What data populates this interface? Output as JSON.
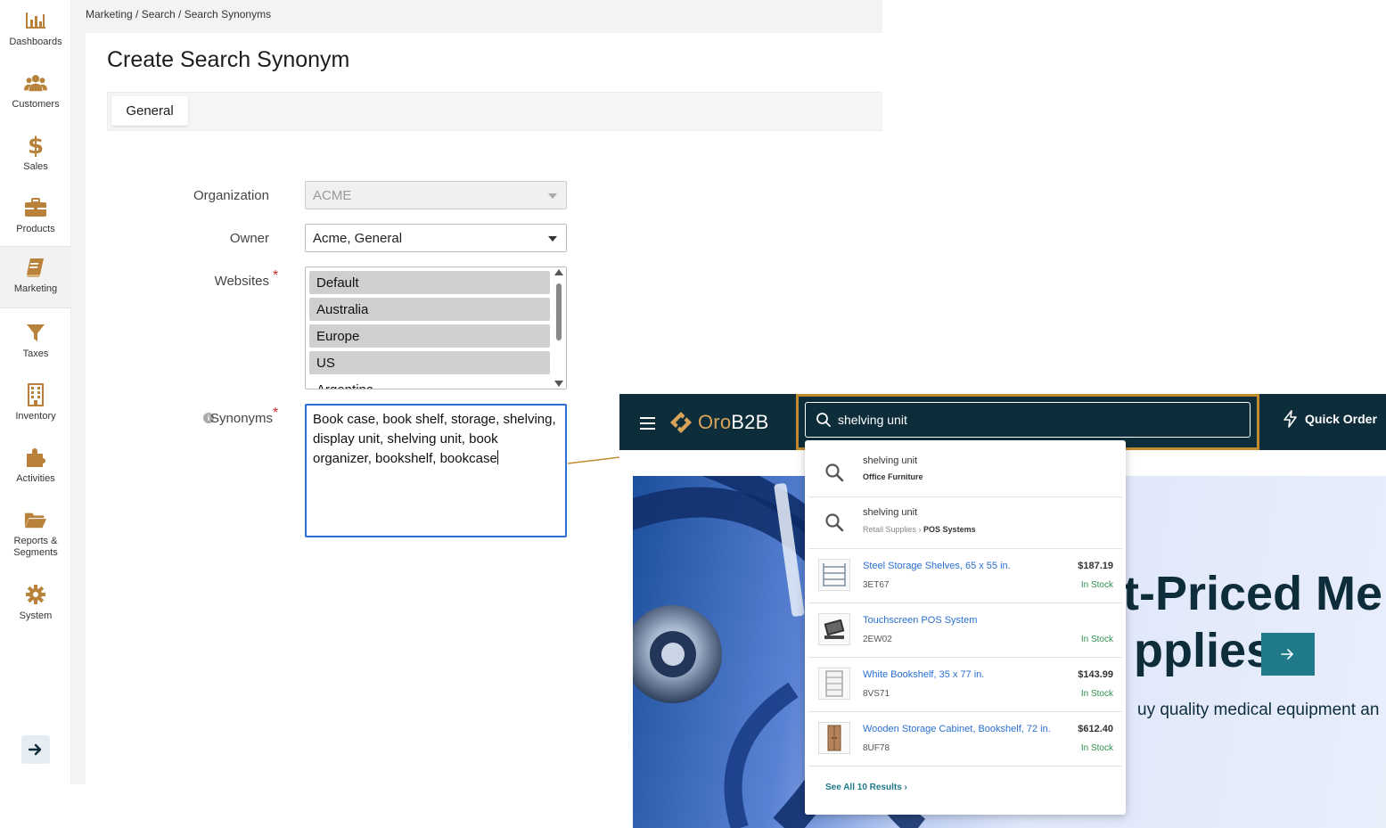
{
  "sidebar": {
    "items": [
      {
        "label": "Dashboards",
        "icon": "bar-chart-icon"
      },
      {
        "label": "Customers",
        "icon": "users-icon"
      },
      {
        "label": "Sales",
        "icon": "dollar-icon"
      },
      {
        "label": "Products",
        "icon": "briefcase-icon"
      },
      {
        "label": "Marketing",
        "icon": "book-icon",
        "active": true
      },
      {
        "label": "Taxes",
        "icon": "funnel-icon"
      },
      {
        "label": "Inventory",
        "icon": "building-icon"
      },
      {
        "label": "Activities",
        "icon": "puzzle-icon"
      },
      {
        "label": "Reports &\nSegments",
        "icon": "folder-icon"
      },
      {
        "label": "System",
        "icon": "gear-icon"
      }
    ]
  },
  "breadcrumb": "Marketing / Search / Search Synonyms",
  "page": {
    "title": "Create Search Synonym",
    "tab_general": "General"
  },
  "form": {
    "organization_label": "Organization",
    "organization_value": "ACME",
    "owner_label": "Owner",
    "owner_value": "Acme, General",
    "websites_label": "Websites",
    "websites_options": [
      "Default",
      "Australia",
      "Europe",
      "US",
      "Argentina"
    ],
    "synonyms_label": "Synonyms",
    "synonyms_value": "Book case, book shelf, storage, shelving, display unit, shelving unit, book organizer, bookshelf, bookcase",
    "required_mark": "*"
  },
  "storefront": {
    "logo_prefix": "Oro",
    "logo_suffix": "B2B",
    "search_value": "shelving unit",
    "quick_order_label": "Quick Order",
    "hero_line1": "t-Priced Me",
    "hero_line2": "pplies",
    "hero_sub": "uy quality medical equipment an",
    "suggestions": [
      {
        "term": "shelving unit",
        "category_path": "",
        "category": "Office Furniture"
      },
      {
        "term": "shelving unit",
        "category_path": "Retail Supplies",
        "category": "POS Systems"
      }
    ],
    "products": [
      {
        "name": "Steel Storage Shelves, 65 x 55 in.",
        "sku": "3ET67",
        "price": "$187.19",
        "stock": "In Stock"
      },
      {
        "name": "Touchscreen POS System",
        "sku": "2EW02",
        "price": "",
        "stock": "In Stock"
      },
      {
        "name": "White Bookshelf, 35 x 77 in.",
        "sku": "8VS71",
        "price": "$143.99",
        "stock": "In Stock"
      },
      {
        "name": "Wooden Storage Cabinet, Bookshelf, 72 in.",
        "sku": "8UF78",
        "price": "$612.40",
        "stock": "In Stock"
      }
    ],
    "see_all_label": "See All 10 Results ›"
  },
  "colors": {
    "accent_gold": "#c08a2e",
    "store_header": "#0e2d3a",
    "link_blue": "#2a6fd1",
    "teal": "#207a8a",
    "in_stock": "#2d8f4e",
    "sidebar_icon": "#b8823a"
  }
}
